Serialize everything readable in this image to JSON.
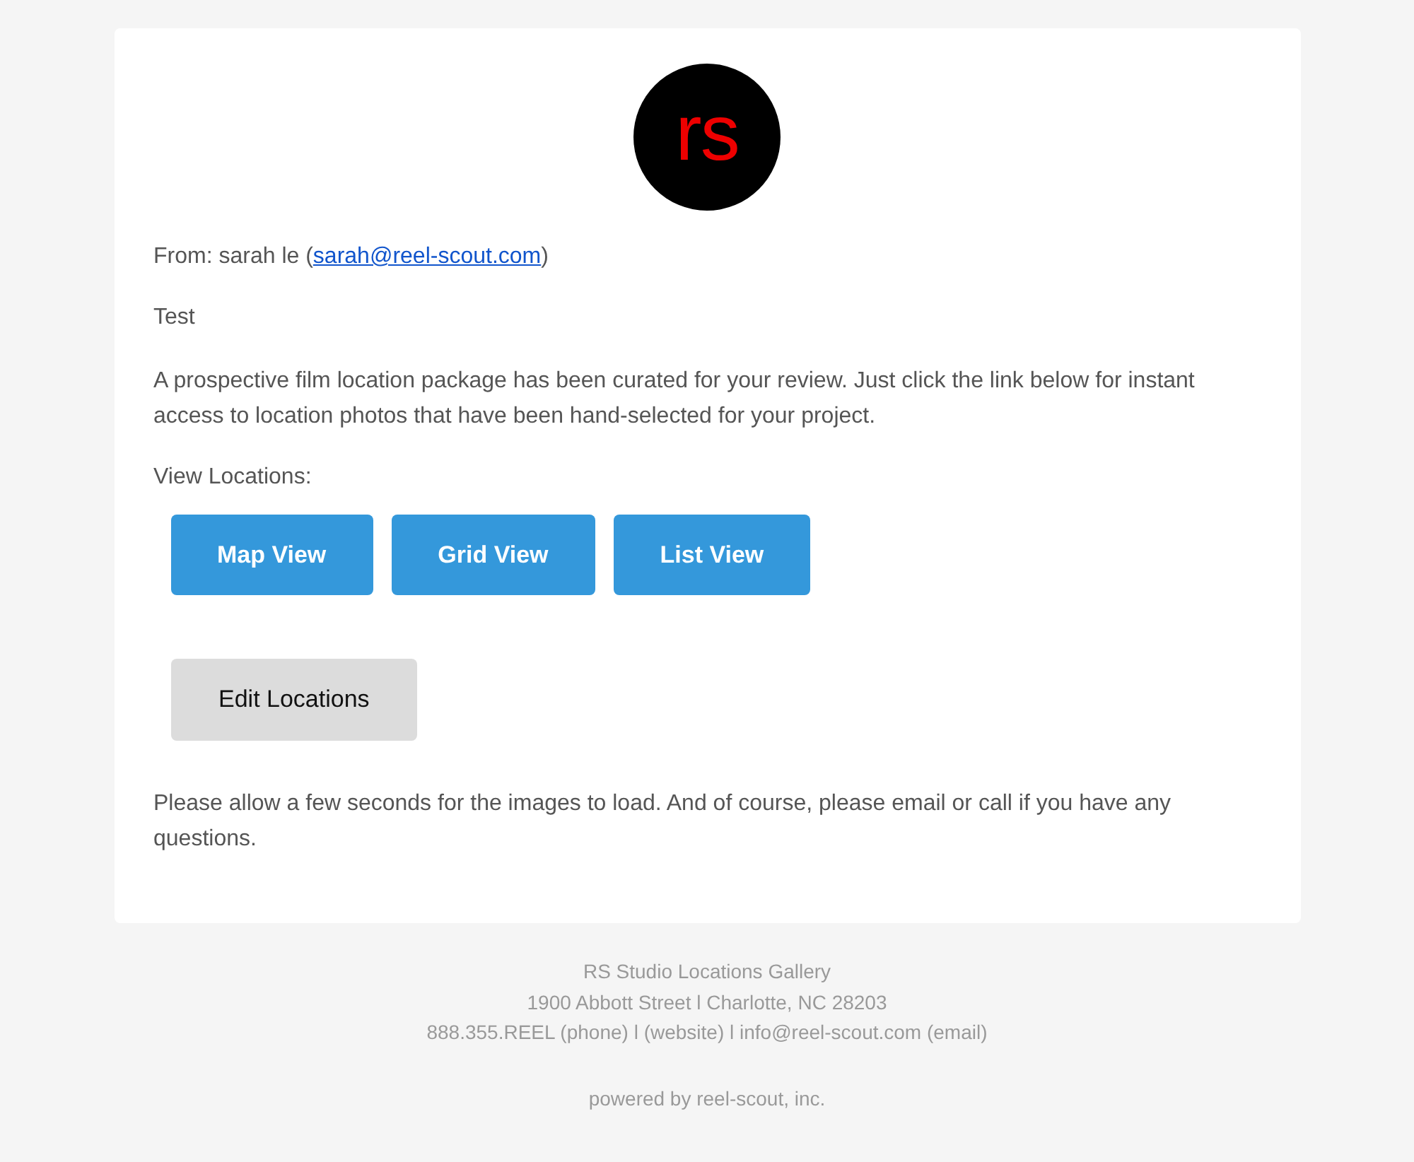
{
  "logo": "rs",
  "from": {
    "prefix": "From: sarah le (",
    "email": "sarah@reel-scout.com",
    "suffix": ")"
  },
  "subject": "Test",
  "message": "A prospective film location package has been curated for your review. Just click the link below for instant access to location photos that have been hand-selected for your project.",
  "view_label": "View Locations:",
  "buttons": [
    {
      "label": "Map View",
      "kind": "primary"
    },
    {
      "label": "Grid View",
      "kind": "primary"
    },
    {
      "label": "List View",
      "kind": "primary"
    },
    {
      "label": "Edit Locations",
      "kind": "secondary"
    }
  ],
  "closing": "Please allow a few seconds for the images to load. And of course, please email or call if you have any questions.",
  "footer": {
    "lines": [
      "RS Studio Locations Gallery",
      "1900 Abbott Street l Charlotte, NC 28203",
      "888.355.REEL (phone) l (website) l info@reel-scout.com (email)"
    ],
    "powered_by": "powered by reel-scout, inc."
  }
}
